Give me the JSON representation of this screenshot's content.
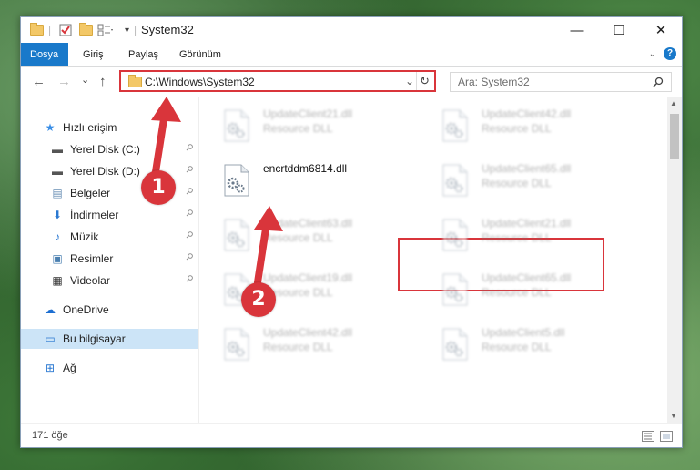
{
  "window": {
    "title": "System32",
    "controls": {
      "minimize": "—",
      "maximize": "☐",
      "close": "✕"
    }
  },
  "ribbon": {
    "tabs": [
      "Dosya",
      "Giriş",
      "Paylaş",
      "Görünüm"
    ],
    "active_tab": "Dosya",
    "expand_icon": "chevron-down-icon",
    "help_label": "?"
  },
  "address": {
    "path": "C:\\Windows\\System32",
    "search_placeholder": "Ara: System32",
    "back_glyph": "←",
    "forward_glyph": "→",
    "recent_glyph": "⌄",
    "up_glyph": "↑",
    "refresh_glyph": "↻",
    "dropdown_glyph": "⌄"
  },
  "nav": {
    "items": [
      {
        "label": "Hızlı erişim",
        "icon": "star-icon",
        "glyph": "★",
        "color": "#3a8ee6",
        "pinned": false
      },
      {
        "label": "Yerel Disk (C:)",
        "icon": "drive-icon",
        "glyph": "▬",
        "color": "#555555",
        "pinned": true
      },
      {
        "label": "Yerel Disk (D:)",
        "icon": "drive-icon",
        "glyph": "▬",
        "color": "#555555",
        "pinned": true
      },
      {
        "label": "Belgeler",
        "icon": "documents-icon",
        "glyph": "▤",
        "color": "#6a8fb5",
        "pinned": true
      },
      {
        "label": "İndirmeler",
        "icon": "download-icon",
        "glyph": "⬇",
        "color": "#2a78d1",
        "pinned": true
      },
      {
        "label": "Müzik",
        "icon": "music-icon",
        "glyph": "♪",
        "color": "#2a78d1",
        "pinned": true
      },
      {
        "label": "Resimler",
        "icon": "pictures-icon",
        "glyph": "▣",
        "color": "#4a7fb0",
        "pinned": true
      },
      {
        "label": "Videolar",
        "icon": "video-icon",
        "glyph": "▦",
        "color": "#333333",
        "pinned": true
      },
      {
        "label": "OneDrive",
        "icon": "cloud-icon",
        "glyph": "☁",
        "color": "#1c6ed1",
        "pinned": false
      },
      {
        "label": "Bu bilgisayar",
        "icon": "computer-icon",
        "glyph": "▭",
        "color": "#2a78d1",
        "pinned": false,
        "selected": true
      },
      {
        "label": "Ağ",
        "icon": "network-icon",
        "glyph": "⊞",
        "color": "#2a78d1",
        "pinned": false
      }
    ],
    "pin_glyph": "📌"
  },
  "files": {
    "highlighted": {
      "name": "encrtddm6814.dll",
      "type": ""
    },
    "blurred": [
      {
        "name": "UpdateClient21.dll",
        "type": "Resource DLL"
      },
      {
        "name": "UpdateClient42.dll",
        "type": "Resource DLL"
      },
      {
        "name": "UpdateClient65.dll",
        "type": "Resource DLL"
      },
      {
        "name": "UpdateClient63.dll",
        "type": "Resource DLL"
      },
      {
        "name": "UpdateClient21.dll",
        "type": "Resource DLL"
      },
      {
        "name": "UpdateClient19.dll",
        "type": "Resource DLL"
      },
      {
        "name": "UpdateClient65.dll",
        "type": "Resource DLL"
      },
      {
        "name": "UpdateClient42.dll",
        "type": "Resource DLL"
      },
      {
        "name": "UpdateClient5.dll",
        "type": "Resource DLL"
      }
    ]
  },
  "status": {
    "count": "171 öğe"
  },
  "annotations": {
    "marker1": "1",
    "marker2": "2",
    "color": "#d9353b"
  }
}
